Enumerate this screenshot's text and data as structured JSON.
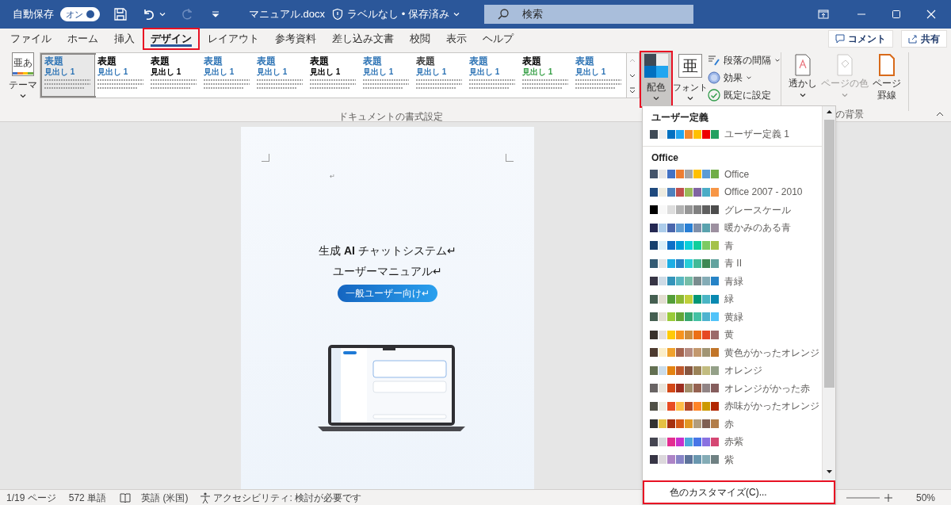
{
  "title_bar": {
    "autosave_label": "自動保存",
    "autosave_toggle": {
      "label": "オン",
      "on": true
    },
    "redo_disabled": true,
    "file_name": "マニュアル.docx",
    "status": "ラベルなし • 保存済み",
    "search": {
      "placeholder": "検索"
    }
  },
  "tabs": [
    {
      "label": "ファイル",
      "selected": false,
      "highlighted": false
    },
    {
      "label": "ホーム",
      "selected": false,
      "highlighted": false
    },
    {
      "label": "挿入",
      "selected": false,
      "highlighted": false
    },
    {
      "label": "デザイン",
      "selected": true,
      "highlighted": true
    },
    {
      "label": "レイアウト",
      "selected": false,
      "highlighted": false
    },
    {
      "label": "参考資料",
      "selected": false,
      "highlighted": false
    },
    {
      "label": "差し込み文書",
      "selected": false,
      "highlighted": false
    },
    {
      "label": "校閲",
      "selected": false,
      "highlighted": false
    },
    {
      "label": "表示",
      "selected": false,
      "highlighted": false
    },
    {
      "label": "ヘルプ",
      "selected": false,
      "highlighted": false
    }
  ],
  "header_buttons": [
    "コメント",
    "共有"
  ],
  "ribbon": {
    "theme_button": {
      "icon_text": "亜あ",
      "label": "テーマ"
    },
    "style_gallery": [
      {
        "title": {
          "text": "表題",
          "color": "#2e74b5"
        },
        "heading": {
          "text": "見出し 1",
          "color": "#2e74b5"
        },
        "selected": true
      },
      {
        "title": {
          "text": "表題",
          "color": "#000000"
        },
        "heading": {
          "text": "見出し 1",
          "color": "#2e74b5"
        },
        "selected": false
      },
      {
        "title": {
          "text": "表題",
          "color": "#000000"
        },
        "heading": {
          "text": "見出し 1",
          "color": "#000000"
        },
        "selected": false
      },
      {
        "title": {
          "text": "表題",
          "color": "#2e74b5"
        },
        "heading": {
          "text": "見出し 1",
          "color": "#2e74b5"
        },
        "selected": false
      },
      {
        "title": {
          "text": "表題",
          "color": "#2e74b5"
        },
        "heading": {
          "text": "見出し 1",
          "color": "#2e74b5"
        },
        "selected": false
      },
      {
        "title": {
          "text": "表題",
          "color": "#000000"
        },
        "heading": {
          "text": "見出し 1",
          "color": "#000000"
        },
        "selected": false
      },
      {
        "title": {
          "text": "表題",
          "color": "#2e74b5"
        },
        "heading": {
          "text": "見出し 1",
          "color": "#2e74b5"
        },
        "selected": false
      },
      {
        "title": {
          "text": "表題",
          "color": "#3a3a3a"
        },
        "heading": {
          "text": "見出し 1",
          "color": "#2e74b5"
        },
        "selected": false
      },
      {
        "title": {
          "text": "表題",
          "color": "#2e74b5"
        },
        "heading": {
          "text": "見出し 1",
          "color": "#2e74b5"
        },
        "selected": false
      },
      {
        "title": {
          "text": "表題",
          "color": "#000000"
        },
        "heading": {
          "text": "見出し 1",
          "color": "#38a048"
        },
        "selected": false
      },
      {
        "title": {
          "text": "表題",
          "color": "#2e74b5"
        },
        "heading": {
          "text": "見出し 1",
          "color": "#2e74b5"
        },
        "selected": false
      }
    ],
    "colors_button": {
      "label": "配色",
      "pressed": true,
      "highlighted": true
    },
    "fonts_button": {
      "icon_text": "亜",
      "label": "フォント"
    },
    "format_options": [
      "段落の間隔",
      "効果",
      "既定に設定"
    ],
    "document_formatting_label": "ドキュメントの書式設定",
    "page_background": [
      {
        "label_lines": [
          "透かし"
        ],
        "disabled": false,
        "kind": "watermark"
      },
      {
        "label_lines": [
          "ページの色"
        ],
        "disabled": true,
        "kind": "page-color"
      },
      {
        "label_lines": [
          "ページ",
          "罫線"
        ],
        "disabled": false,
        "kind": "page-border"
      }
    ],
    "page_background_label": "の背景"
  },
  "document": {
    "empty_paragraph_mark": "↵",
    "title_line_1": "生成 **AI** チャットシステム↵",
    "title_line_2": "ユーザーマニュアル↵",
    "audience_badge": "一般ユーザー向け↵"
  },
  "color_dropdown": {
    "sections": [
      {
        "header": "ユーザー定義",
        "schemes": [
          {
            "name": "ユーザー定義 1",
            "colors": [
              {
                "color": "#3f4a56"
              },
              {
                "color": "#eeeeee"
              },
              {
                "color": "#0070c0"
              },
              {
                "color": "#21a6f0"
              },
              {
                "color": "#f28a2e"
              },
              {
                "color": "#ffc000"
              },
              {
                "color": "#ee0000"
              },
              {
                "color": "#23a060"
              }
            ]
          }
        ]
      },
      {
        "header": "Office",
        "schemes": [
          {
            "name": "Office",
            "colors": [
              {
                "color": "#44546a"
              },
              {
                "color": "#e7e6e6"
              },
              {
                "color": "#4472c4"
              },
              {
                "color": "#ed7d31"
              },
              {
                "color": "#a5a5a5"
              },
              {
                "color": "#ffc000"
              },
              {
                "color": "#5b9bd5"
              },
              {
                "color": "#70ad47"
              }
            ]
          },
          {
            "name": "Office 2007 - 2010",
            "colors": [
              {
                "color": "#1f497d"
              },
              {
                "color": "#eeece1"
              },
              {
                "color": "#4f81bd"
              },
              {
                "color": "#c0504d"
              },
              {
                "color": "#9bbb59"
              },
              {
                "color": "#8064a2"
              },
              {
                "color": "#4bacc6"
              },
              {
                "color": "#f79646"
              }
            ]
          },
          {
            "name": "グレースケール",
            "colors": [
              {
                "color": "#000000"
              },
              {
                "color": "#f8f8f8"
              },
              {
                "color": "#dddddd"
              },
              {
                "color": "#b2b2b2"
              },
              {
                "color": "#969696"
              },
              {
                "color": "#808080"
              },
              {
                "color": "#5f5f5f"
              },
              {
                "color": "#4d4d4d"
              }
            ]
          },
          {
            "name": "暖かみのある青",
            "colors": [
              {
                "color": "#242852"
              },
              {
                "color": "#acccea"
              },
              {
                "color": "#4a66ac"
              },
              {
                "color": "#629dd1"
              },
              {
                "color": "#297fd5"
              },
              {
                "color": "#7f8fa9"
              },
              {
                "color": "#5aa2ae"
              },
              {
                "color": "#9d90a0"
              }
            ]
          },
          {
            "name": "青",
            "colors": [
              {
                "color": "#17406d"
              },
              {
                "color": "#dbeff9"
              },
              {
                "color": "#0f6fc6"
              },
              {
                "color": "#009dd9"
              },
              {
                "color": "#0bd0d9"
              },
              {
                "color": "#10cf9b"
              },
              {
                "color": "#7cca62"
              },
              {
                "color": "#a5c249"
              }
            ]
          },
          {
            "name": "青 II",
            "colors": [
              {
                "color": "#335b74"
              },
              {
                "color": "#dfe3e5"
              },
              {
                "color": "#1cade4"
              },
              {
                "color": "#2683c6"
              },
              {
                "color": "#27ced7"
              },
              {
                "color": "#42ba97"
              },
              {
                "color": "#3e8853"
              },
              {
                "color": "#62a39f"
              }
            ]
          },
          {
            "name": "青緑",
            "colors": [
              {
                "color": "#373545"
              },
              {
                "color": "#cedbe6"
              },
              {
                "color": "#3494ba"
              },
              {
                "color": "#58b6c0"
              },
              {
                "color": "#75bda7"
              },
              {
                "color": "#7a8c8e"
              },
              {
                "color": "#84acb6"
              },
              {
                "color": "#2683c6"
              }
            ]
          },
          {
            "name": "緑",
            "colors": [
              {
                "color": "#455f51"
              },
              {
                "color": "#e3ded1"
              },
              {
                "color": "#549e39"
              },
              {
                "color": "#8ab833"
              },
              {
                "color": "#c0cf3a"
              },
              {
                "color": "#029676"
              },
              {
                "color": "#4ab5c4"
              },
              {
                "color": "#0989b1"
              }
            ]
          },
          {
            "name": "黄緑",
            "colors": [
              {
                "color": "#455f51"
              },
              {
                "color": "#e3ded1"
              },
              {
                "color": "#99cb38"
              },
              {
                "color": "#63a537"
              },
              {
                "color": "#37a76f"
              },
              {
                "color": "#44c1a3"
              },
              {
                "color": "#4eb3cf"
              },
              {
                "color": "#51c3f9"
              }
            ]
          },
          {
            "name": "黄",
            "colors": [
              {
                "color": "#39302a"
              },
              {
                "color": "#e5dedb"
              },
              {
                "color": "#ffca08"
              },
              {
                "color": "#f8931d"
              },
              {
                "color": "#ce8d3e"
              },
              {
                "color": "#ec7016"
              },
              {
                "color": "#e64823"
              },
              {
                "color": "#9c6a6a"
              }
            ]
          },
          {
            "name": "黄色がかったオレンジ",
            "colors": [
              {
                "color": "#4e3b30"
              },
              {
                "color": "#fbeec9"
              },
              {
                "color": "#f0a22e"
              },
              {
                "color": "#a5644e"
              },
              {
                "color": "#b58b80"
              },
              {
                "color": "#c3986d"
              },
              {
                "color": "#a19574"
              },
              {
                "color": "#c17529"
              }
            ]
          },
          {
            "name": "オレンジ",
            "colors": [
              {
                "color": "#637052"
              },
              {
                "color": "#ccddea"
              },
              {
                "color": "#e48312"
              },
              {
                "color": "#bd582c"
              },
              {
                "color": "#865640"
              },
              {
                "color": "#9b8357"
              },
              {
                "color": "#c2bc80"
              },
              {
                "color": "#94a088"
              }
            ]
          },
          {
            "name": "オレンジがかった赤",
            "colors": [
              {
                "color": "#696464"
              },
              {
                "color": "#e9e5dc"
              },
              {
                "color": "#d34817"
              },
              {
                "color": "#9b2d1f"
              },
              {
                "color": "#a28e6a"
              },
              {
                "color": "#956251"
              },
              {
                "color": "#918485"
              },
              {
                "color": "#855d5d"
              }
            ]
          },
          {
            "name": "赤味がかったオレンジ",
            "colors": [
              {
                "color": "#505046"
              },
              {
                "color": "#eeece1"
              },
              {
                "color": "#e84c22"
              },
              {
                "color": "#ffbd47"
              },
              {
                "color": "#b64926"
              },
              {
                "color": "#ff8427"
              },
              {
                "color": "#cc9900"
              },
              {
                "color": "#b22600"
              }
            ]
          },
          {
            "name": "赤",
            "colors": [
              {
                "color": "#323232"
              },
              {
                "color": "#e5c243"
              },
              {
                "color": "#a5300f"
              },
              {
                "color": "#d55816"
              },
              {
                "color": "#e19825"
              },
              {
                "color": "#b19c7d"
              },
              {
                "color": "#7f5f52"
              },
              {
                "color": "#b27d49"
              }
            ]
          },
          {
            "name": "赤紫",
            "colors": [
              {
                "color": "#454551"
              },
              {
                "color": "#d8d9dc"
              },
              {
                "color": "#e32d91"
              },
              {
                "color": "#c830cc"
              },
              {
                "color": "#4ea6dc"
              },
              {
                "color": "#4775e7"
              },
              {
                "color": "#8971e1"
              },
              {
                "color": "#d54773"
              }
            ]
          },
          {
            "name": "紫",
            "colors": [
              {
                "color": "#373545"
              },
              {
                "color": "#dcd8dc"
              },
              {
                "color": "#ad84c6"
              },
              {
                "color": "#8784c7"
              },
              {
                "color": "#5d739a"
              },
              {
                "color": "#6997af"
              },
              {
                "color": "#84acb6"
              },
              {
                "color": "#6f8183"
              }
            ]
          }
        ]
      }
    ],
    "footer": {
      "label": "色のカスタマイズ(C)...",
      "highlighted": true
    }
  },
  "status_bar": {
    "page": "1/19 ページ",
    "words": "572 単語",
    "language": "英語 (米国)",
    "accessibility": "アクセシビリティ: 検討が必要です",
    "zoom": "50%"
  }
}
